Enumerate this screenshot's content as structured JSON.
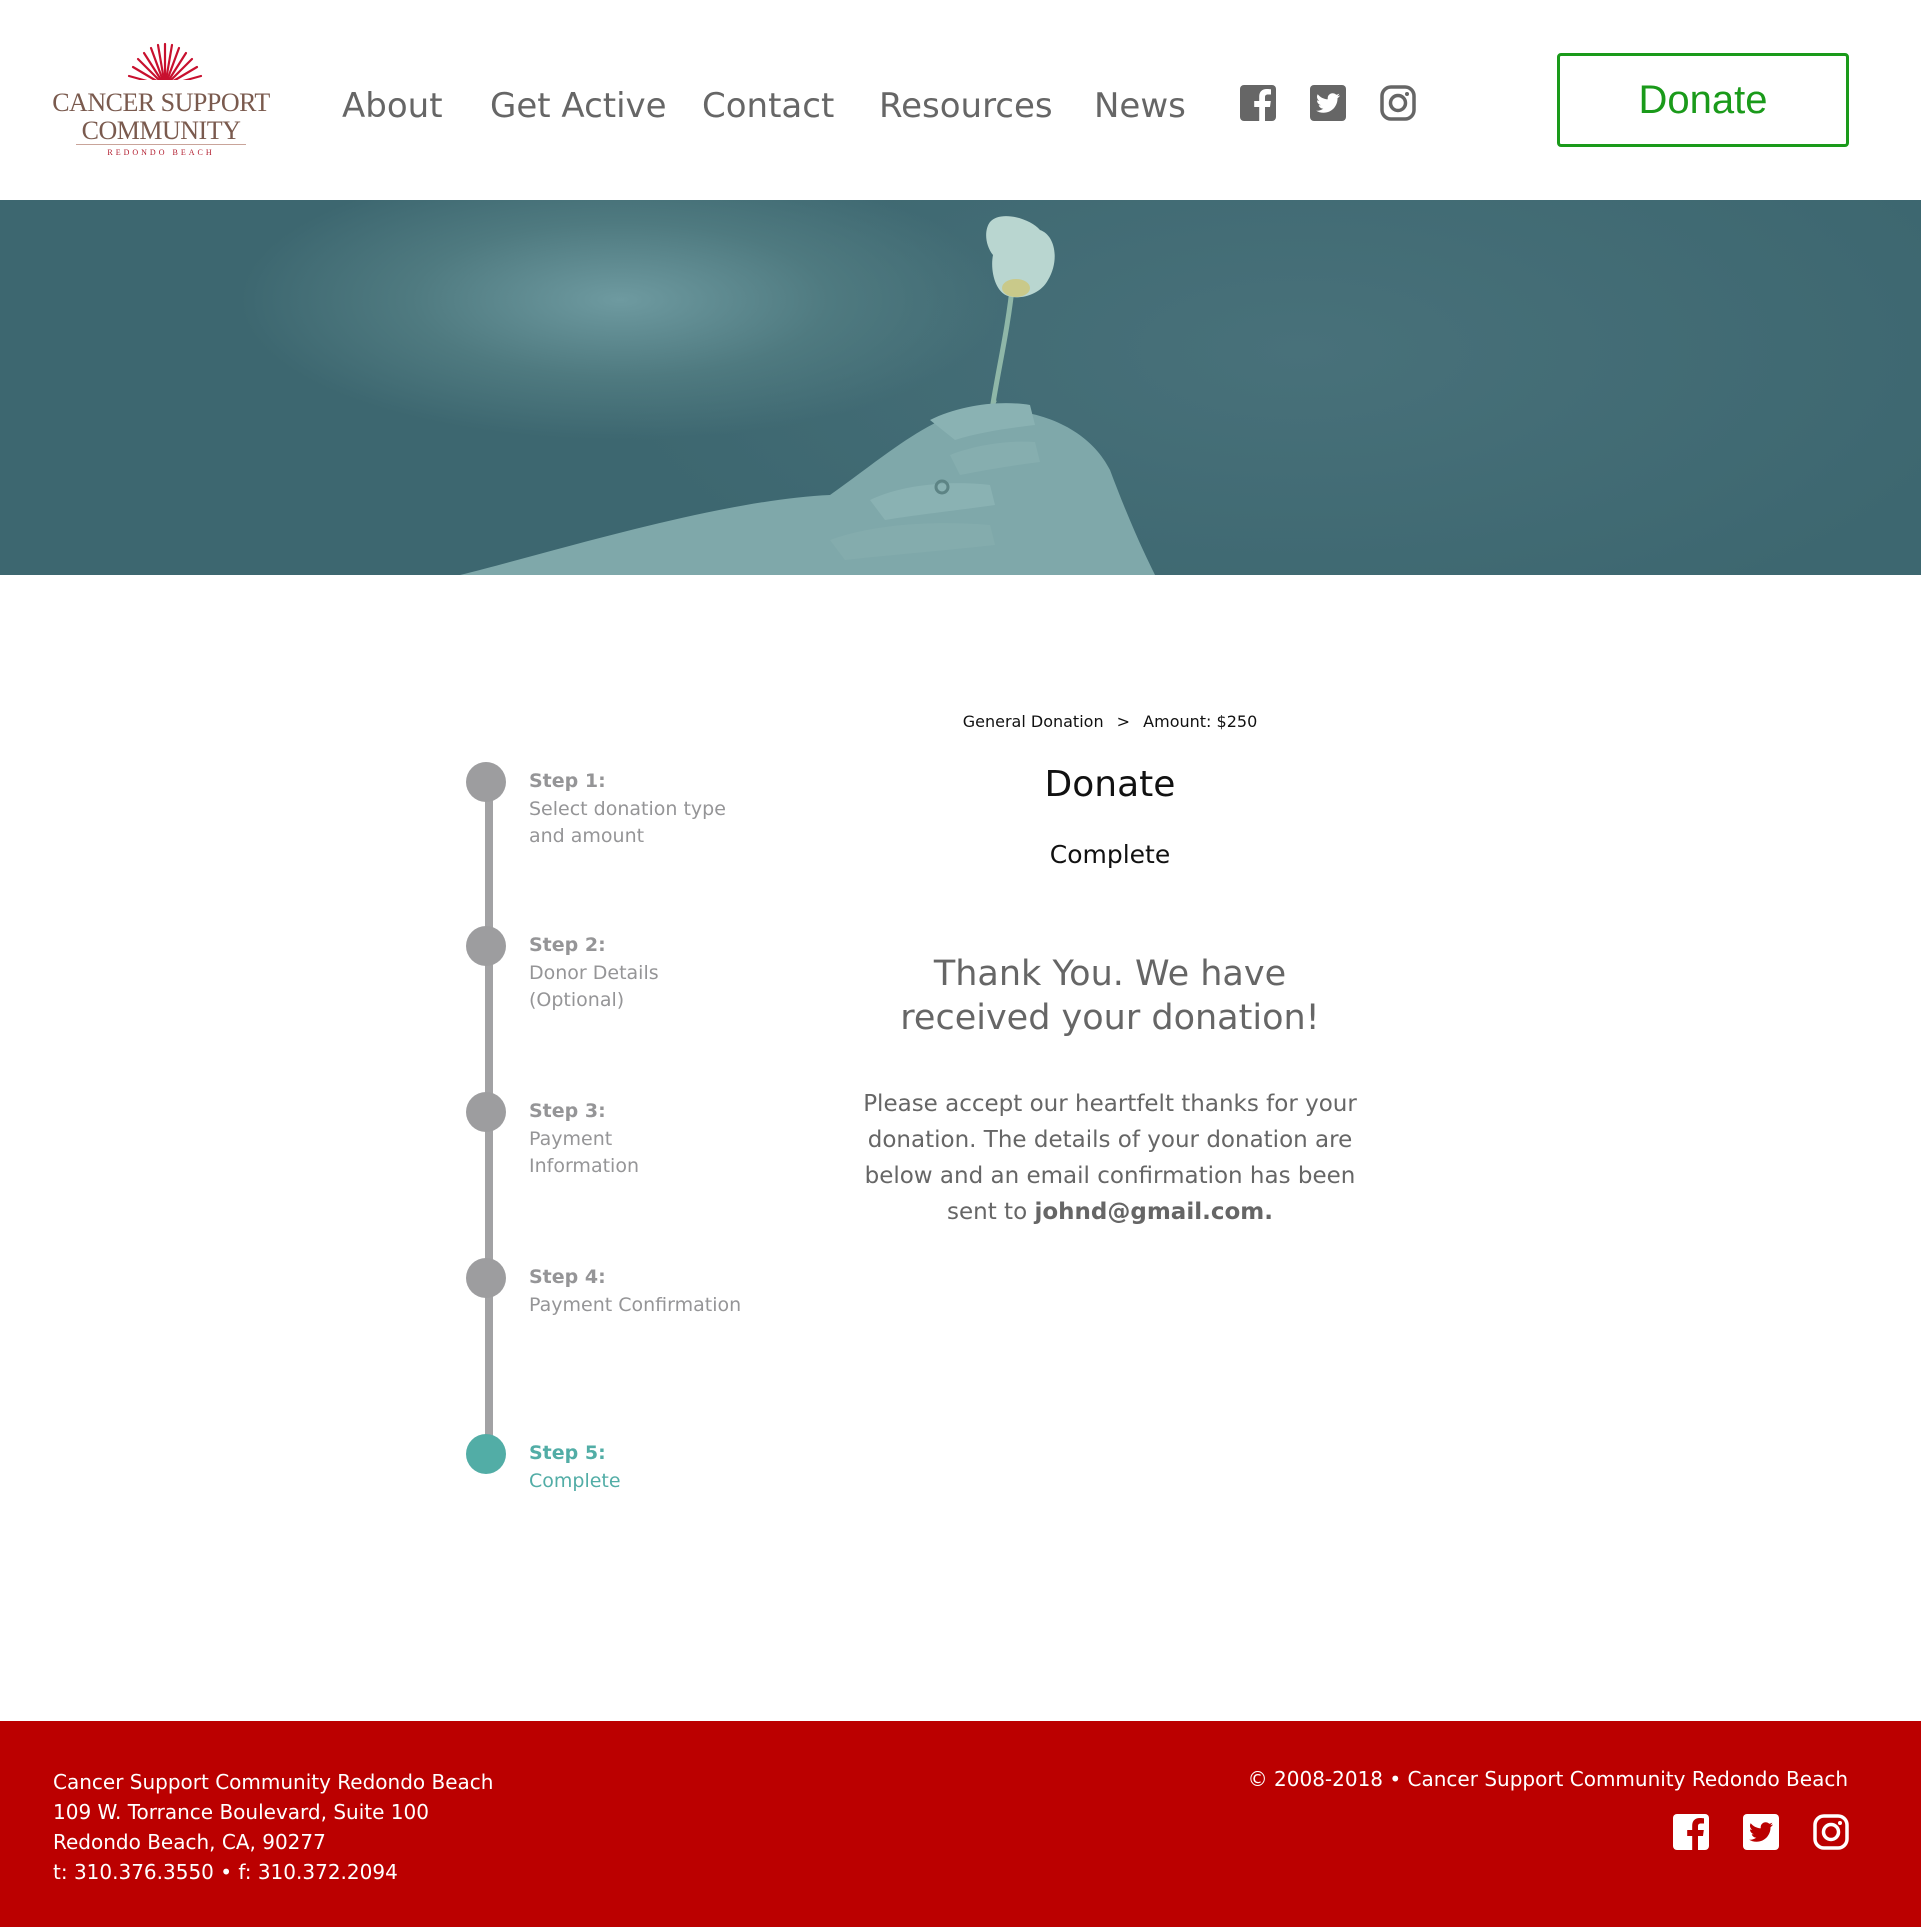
{
  "header": {
    "logo": {
      "line1": "CANCER SUPPORT",
      "line2": "COMMUNITY",
      "line3": "REDONDO BEACH"
    },
    "nav": [
      {
        "label": "About"
      },
      {
        "label": "Get Active"
      },
      {
        "label": "Contact"
      },
      {
        "label": "Resources"
      },
      {
        "label": "News"
      }
    ],
    "social_icons": [
      "facebook-icon",
      "twitter-icon",
      "instagram-icon"
    ],
    "donate_label": "Donate",
    "colors": {
      "donate": "#1a9a1a",
      "nav_text": "#666666",
      "logo_red": "#c8102e"
    }
  },
  "stepper": {
    "steps": [
      {
        "label": "Step 1:",
        "desc": "Select donation type and amount",
        "active": false
      },
      {
        "label": "Step 2:",
        "desc": "Donor Details (Optional)",
        "active": false
      },
      {
        "label": "Step 3:",
        "desc": "Payment Information",
        "active": false
      },
      {
        "label": "Step 4:",
        "desc": "Payment Confirmation",
        "active": false
      },
      {
        "label": "Step 5:",
        "desc": "Complete",
        "active": true
      }
    ],
    "colors": {
      "inactive": "#9d9d9f",
      "active": "#52ada6"
    }
  },
  "main": {
    "breadcrumb": {
      "type": "General Donation",
      "separator": ">",
      "amount": "Amount: $250"
    },
    "title": "Donate",
    "subtitle": "Complete",
    "thank_you": "Thank You. We have received your donation!",
    "message": "Please accept our heartfelt thanks for your donation. The details of your donation are below and an email confirmation has been sent to",
    "email": "johnd@gmail.com."
  },
  "footer": {
    "address": [
      "Cancer Support Community Redondo Beach",
      "109 W. Torrance Boulevard, Suite 100",
      "Redondo Beach, CA, 90277",
      "t: 310.376.3550 • f: 310.372.2094"
    ],
    "copyright": "© 2008-2018 • Cancer Support Community Redondo Beach",
    "social_icons": [
      "facebook-icon",
      "twitter-icon",
      "instagram-icon"
    ],
    "background": "#bb0000"
  }
}
